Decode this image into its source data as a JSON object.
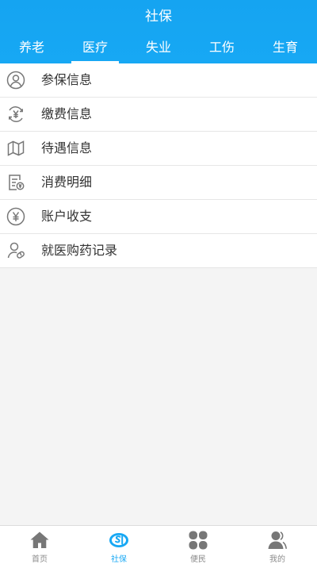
{
  "header": {
    "title": "社保"
  },
  "tabs": [
    {
      "label": "养老"
    },
    {
      "label": "医疗",
      "active": true
    },
    {
      "label": "失业"
    },
    {
      "label": "工伤"
    },
    {
      "label": "生育"
    }
  ],
  "menu": [
    {
      "label": "参保信息",
      "icon": "person-icon"
    },
    {
      "label": "缴费信息",
      "icon": "yuan-refresh-icon"
    },
    {
      "label": "待遇信息",
      "icon": "map-icon"
    },
    {
      "label": "消费明细",
      "icon": "bill-icon"
    },
    {
      "label": "账户收支",
      "icon": "yuan-circle-icon"
    },
    {
      "label": "就医购药记录",
      "icon": "person-pill-icon"
    }
  ],
  "tabbar": [
    {
      "label": "首页",
      "icon": "home-icon"
    },
    {
      "label": "社保",
      "icon": "social-security-icon",
      "active": true
    },
    {
      "label": "便民",
      "icon": "grid-icon"
    },
    {
      "label": "我的",
      "icon": "user-icon"
    }
  ],
  "colors": {
    "primary": "#17a8f4",
    "icon_gray": "#777777",
    "tab_inactive": "#8c8c8c"
  }
}
